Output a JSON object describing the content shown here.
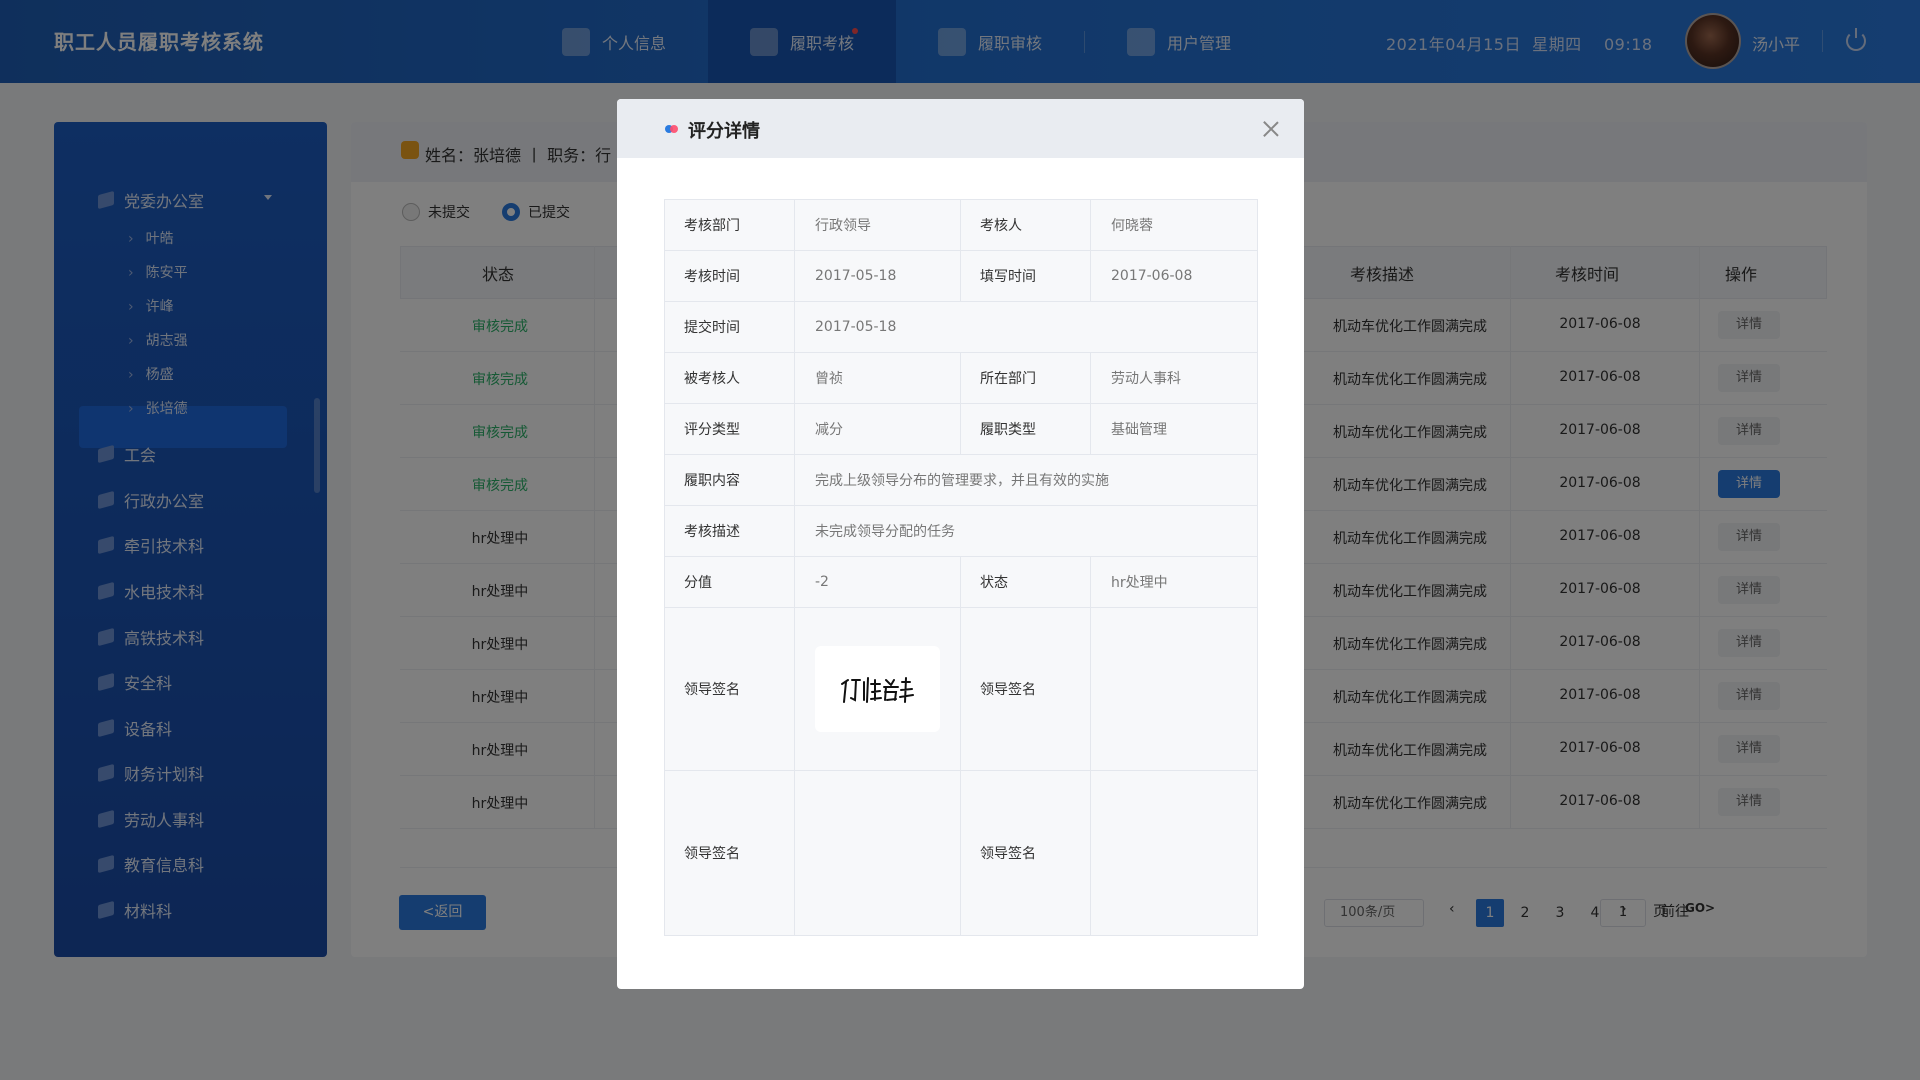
{
  "header": {
    "app_title": "职工人员履职考核系统",
    "nav": [
      {
        "label": "个人信息",
        "icon": "person-icon"
      },
      {
        "label": "履职考核",
        "icon": "document-icon",
        "active": true,
        "badge": true
      },
      {
        "label": "履职审核",
        "icon": "calendar-check-icon"
      },
      {
        "label": "用户管理",
        "icon": "grid-icon"
      }
    ],
    "date": "2021年04月15日",
    "weekday": "星期四",
    "time": "09:18",
    "user_name": "汤小平"
  },
  "sidebar": {
    "groups": [
      {
        "label": "党委办公室",
        "expanded": true,
        "children": [
          "叶皓",
          "陈安平",
          "许峰",
          "胡志强",
          "杨盛",
          "张培德"
        ],
        "active_child": "许峰"
      },
      {
        "label": "工会"
      },
      {
        "label": "行政办公室"
      },
      {
        "label": "牵引技术科"
      },
      {
        "label": "水电技术科"
      },
      {
        "label": "高铁技术科"
      },
      {
        "label": "安全科"
      },
      {
        "label": "设备科"
      },
      {
        "label": "财务计划科"
      },
      {
        "label": "劳动人事科"
      },
      {
        "label": "教育信息科"
      },
      {
        "label": "材料科"
      }
    ]
  },
  "main": {
    "person_info": "姓名：张培德   丨   职务：行",
    "radios": [
      {
        "label": "未提交",
        "checked": false
      },
      {
        "label": "已提交",
        "checked": true
      }
    ],
    "columns": {
      "status": "状态",
      "desc": "考核描述",
      "time": "考核时间",
      "action": "操作"
    },
    "rows": [
      {
        "status": "审核完成",
        "desc": "机动车优化工作圆满完成",
        "time": "2017-06-08",
        "action": "详情"
      },
      {
        "status": "审核完成",
        "desc": "机动车优化工作圆满完成",
        "time": "2017-06-08",
        "action": "详情"
      },
      {
        "status": "审核完成",
        "desc": "机动车优化工作圆满完成",
        "time": "2017-06-08",
        "action": "详情"
      },
      {
        "status": "审核完成",
        "desc": "机动车优化工作圆满完成",
        "time": "2017-06-08",
        "action": "详情",
        "highlight": true
      },
      {
        "status": "hr处理中",
        "desc": "机动车优化工作圆满完成",
        "time": "2017-06-08",
        "action": "详情"
      },
      {
        "status": "hr处理中",
        "desc": "机动车优化工作圆满完成",
        "time": "2017-06-08",
        "action": "详情"
      },
      {
        "status": "hr处理中",
        "desc": "机动车优化工作圆满完成",
        "time": "2017-06-08",
        "action": "详情"
      },
      {
        "status": "hr处理中",
        "desc": "机动车优化工作圆满完成",
        "time": "2017-06-08",
        "action": "详情"
      },
      {
        "status": "hr处理中",
        "desc": "机动车优化工作圆满完成",
        "time": "2017-06-08",
        "action": "详情"
      },
      {
        "status": "hr处理中",
        "desc": "机动车优化工作圆满完成",
        "time": "2017-06-08",
        "action": "详情"
      }
    ],
    "back_label": "<返回",
    "page_size": "100条/页",
    "pages": [
      "1",
      "2",
      "3",
      "4"
    ],
    "current_page": "1",
    "goto_prefix": "前往",
    "goto_value": "1",
    "goto_suffix": "页",
    "go_label": "GO>"
  },
  "modal": {
    "title": "评分详情",
    "fields": {
      "dept_label": "考核部门",
      "dept_value": "行政领导",
      "assessor_label": "考核人",
      "assessor_value": "何晓蓉",
      "assess_time_label": "考核时间",
      "assess_time_value": "2017-05-18",
      "fill_time_label": "填写时间",
      "fill_time_value": "2017-06-08",
      "submit_time_label": "提交时间",
      "submit_time_value": "2017-05-18",
      "assessee_label": "被考核人",
      "assessee_value": "曾祯",
      "dept2_label": "所在部门",
      "dept2_value": "劳动人事科",
      "score_type_label": "评分类型",
      "score_type_value": "减分",
      "duty_type_label": "履职类型",
      "duty_type_value": "基础管理",
      "duty_content_label": "履职内容",
      "duty_content_value": "完成上级领导分布的管理要求，并且有效的实施",
      "assess_desc_label": "考核描述",
      "assess_desc_value": "未完成领导分配的任务",
      "score_label": "分值",
      "score_value": "-2",
      "status_label": "状态",
      "status_value": "hr处理中",
      "sign_label": "领导签名",
      "signature_text": "何晓蓉"
    }
  }
}
